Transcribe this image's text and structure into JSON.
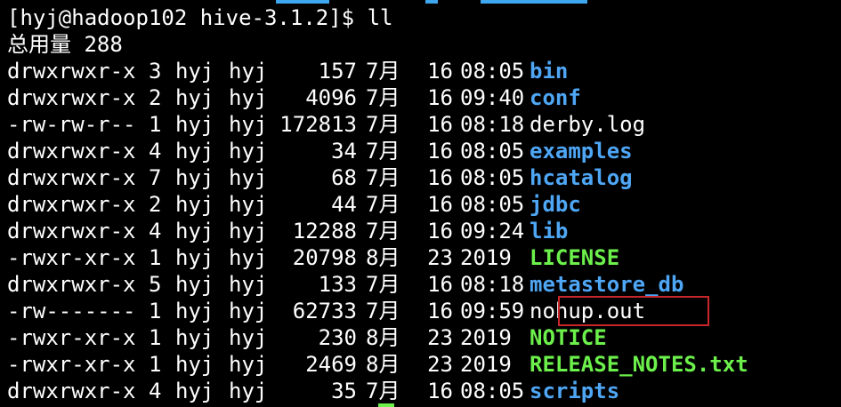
{
  "terminal": {
    "prompt": "[hyj@hadoop102 hive-3.1.2]$ ll",
    "total": "总用量 288",
    "colors": {
      "background": "#000000",
      "text": "#ffffff",
      "directory": "#4ea6f5",
      "executable": "#6cf04b",
      "highlight_box": "#c8262a"
    },
    "rows": [
      {
        "perm": "drwxrwxr-x",
        "links": "3",
        "owner": "hyj",
        "group": "hyj",
        "size": "157",
        "month": "7月",
        "day": "16",
        "time": "08:05",
        "name": "bin",
        "kind": "dir"
      },
      {
        "perm": "drwxrwxr-x",
        "links": "2",
        "owner": "hyj",
        "group": "hyj",
        "size": "4096",
        "month": "7月",
        "day": "16",
        "time": "09:40",
        "name": "conf",
        "kind": "dir"
      },
      {
        "perm": "-rw-rw-r--",
        "links": "1",
        "owner": "hyj",
        "group": "hyj",
        "size": "172813",
        "month": "7月",
        "day": "16",
        "time": "08:18",
        "name": "derby.log",
        "kind": "file"
      },
      {
        "perm": "drwxrwxr-x",
        "links": "4",
        "owner": "hyj",
        "group": "hyj",
        "size": "34",
        "month": "7月",
        "day": "16",
        "time": "08:05",
        "name": "examples",
        "kind": "dir"
      },
      {
        "perm": "drwxrwxr-x",
        "links": "7",
        "owner": "hyj",
        "group": "hyj",
        "size": "68",
        "month": "7月",
        "day": "16",
        "time": "08:05",
        "name": "hcatalog",
        "kind": "dir"
      },
      {
        "perm": "drwxrwxr-x",
        "links": "2",
        "owner": "hyj",
        "group": "hyj",
        "size": "44",
        "month": "7月",
        "day": "16",
        "time": "08:05",
        "name": "jdbc",
        "kind": "dir"
      },
      {
        "perm": "drwxrwxr-x",
        "links": "4",
        "owner": "hyj",
        "group": "hyj",
        "size": "12288",
        "month": "7月",
        "day": "16",
        "time": "09:24",
        "name": "lib",
        "kind": "dir"
      },
      {
        "perm": "-rwxr-xr-x",
        "links": "1",
        "owner": "hyj",
        "group": "hyj",
        "size": "20798",
        "month": "8月",
        "day": "23",
        "time": "2019",
        "name": "LICENSE",
        "kind": "exec"
      },
      {
        "perm": "drwxrwxr-x",
        "links": "5",
        "owner": "hyj",
        "group": "hyj",
        "size": "133",
        "month": "7月",
        "day": "16",
        "time": "08:18",
        "name": "metastore_db",
        "kind": "dir"
      },
      {
        "perm": "-rw-------",
        "links": "1",
        "owner": "hyj",
        "group": "hyj",
        "size": "62733",
        "month": "7月",
        "day": "16",
        "time": "09:59",
        "name": "nohup.out",
        "kind": "file"
      },
      {
        "perm": "-rwxr-xr-x",
        "links": "1",
        "owner": "hyj",
        "group": "hyj",
        "size": "230",
        "month": "8月",
        "day": "23",
        "time": "2019",
        "name": "NOTICE",
        "kind": "exec"
      },
      {
        "perm": "-rwxr-xr-x",
        "links": "1",
        "owner": "hyj",
        "group": "hyj",
        "size": "2469",
        "month": "8月",
        "day": "23",
        "time": "2019",
        "name": "RELEASE_NOTES.txt",
        "kind": "exec"
      },
      {
        "perm": "drwxrwxr-x",
        "links": "4",
        "owner": "hyj",
        "group": "hyj",
        "size": "35",
        "month": "7月",
        "day": "16",
        "time": "08:05",
        "name": "scripts",
        "kind": "dir"
      }
    ]
  }
}
